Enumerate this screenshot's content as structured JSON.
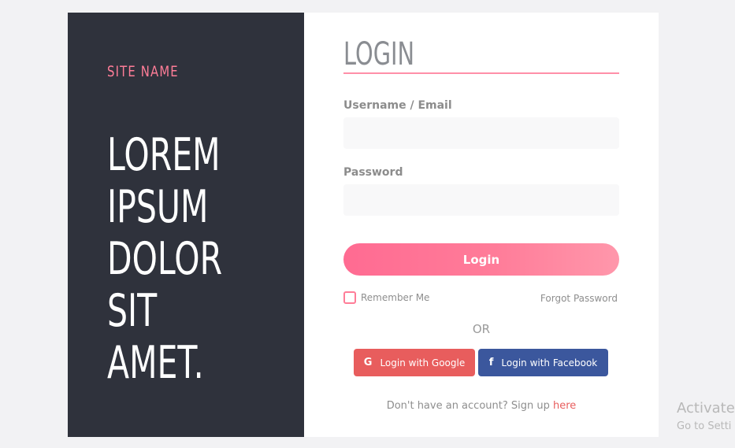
{
  "brand": {
    "site_name": "SITE NAME",
    "hero_lines": [
      "LOREM",
      "IPSUM",
      "DOLOR",
      "SIT",
      "AMET."
    ]
  },
  "form": {
    "title": "LOGIN",
    "username_label": "Username / Email",
    "username_value": "",
    "password_label": "Password",
    "password_value": "",
    "login_label": "Login",
    "remember_label": "Remember Me",
    "remember_checked": false,
    "forgot_label": "Forgot Password",
    "or_label": "OR",
    "google_label": "Login with Google",
    "google_icon": "G",
    "facebook_label": "Login with Facebook",
    "facebook_icon": "f",
    "signup_text": "Don't have an account? Sign up",
    "signup_link": "here"
  },
  "watermark": {
    "title": "Activate",
    "subtitle": "Go to Setti"
  },
  "colors": {
    "accent": "#ff7d98",
    "panel": "#2f323c",
    "google": "#e85d5d",
    "facebook": "#3b579d"
  }
}
